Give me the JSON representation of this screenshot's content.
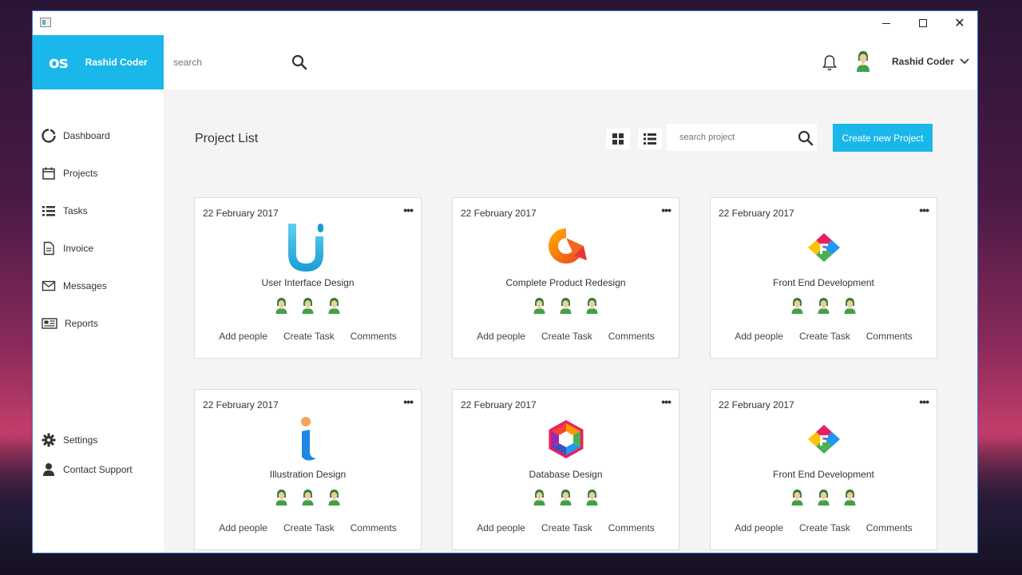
{
  "brand": {
    "logo": "os",
    "name": "Rashid Coder"
  },
  "header": {
    "search_placeholder": "search",
    "user_name": "Rashid Coder"
  },
  "sidebar": {
    "items": [
      {
        "label": "Dashboard",
        "icon": "circle-icon"
      },
      {
        "label": "Projects",
        "icon": "calendar-icon"
      },
      {
        "label": "Tasks",
        "icon": "list-icon"
      },
      {
        "label": "Invoice",
        "icon": "document-icon"
      },
      {
        "label": "Messages",
        "icon": "envelope-icon"
      },
      {
        "label": "Reports",
        "icon": "newspaper-icon"
      }
    ],
    "bottom": [
      {
        "label": "Settings",
        "icon": "gear-icon"
      },
      {
        "label": "Contact Support",
        "icon": "user-icon"
      }
    ]
  },
  "main": {
    "title": "Project List",
    "search_placeholder": "search project",
    "create_label": "Create new Project",
    "cards": [
      {
        "date": "22 February 2017",
        "title": "User Interface Design",
        "logo": "ui-logo"
      },
      {
        "date": "22 February 2017",
        "title": "Complete Product Redesign",
        "logo": "q-logo"
      },
      {
        "date": "22 February 2017",
        "title": "Front End Development",
        "logo": "f-logo"
      },
      {
        "date": "22 February 2017",
        "title": "Illustration Design",
        "logo": "i-logo"
      },
      {
        "date": "22 February 2017",
        "title": "Database Design",
        "logo": "hex-logo"
      },
      {
        "date": "22 February 2017",
        "title": "Front End Development",
        "logo": "f-logo"
      }
    ],
    "card_actions": {
      "add_people": "Add people",
      "create_task": "Create Task",
      "comments": "Comments"
    },
    "card_menu": "•••"
  },
  "colors": {
    "accent": "#1ab7ea",
    "background": "#f4f4f4"
  }
}
